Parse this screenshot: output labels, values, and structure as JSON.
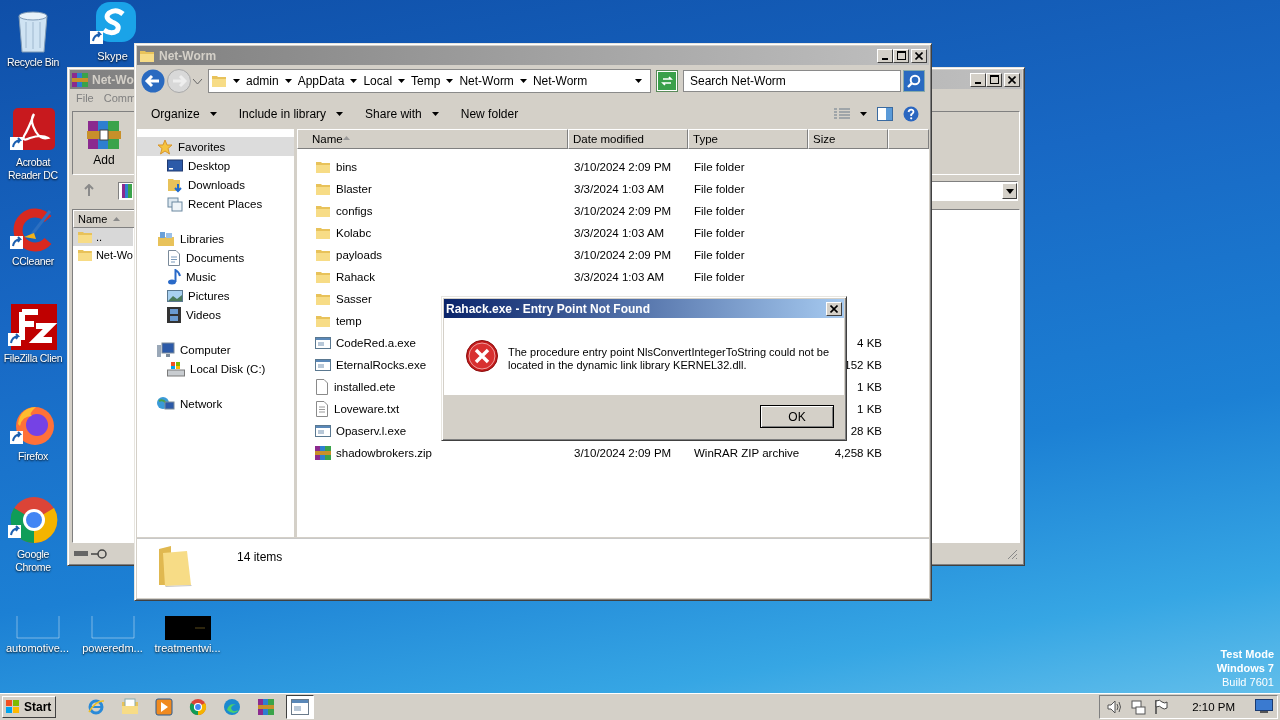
{
  "desktop": {
    "icons": [
      {
        "label": "Recycle Bin",
        "kind": "recycle-bin"
      },
      {
        "label": "Skype",
        "kind": "skype"
      },
      {
        "label": "Acrobat Reader DC",
        "kind": "acrobat"
      },
      {
        "label": "CCleaner",
        "kind": "ccleaner"
      },
      {
        "label": "FileZilla Clien",
        "kind": "filezilla"
      },
      {
        "label": "Firefox",
        "kind": "firefox"
      },
      {
        "label": "Google Chrome",
        "kind": "chrome"
      },
      {
        "label": "automotive...",
        "kind": "blank"
      },
      {
        "label": "poweredm...",
        "kind": "blank"
      },
      {
        "label": "treatmentwi...",
        "kind": "dark"
      }
    ],
    "watermark_text": [
      "Test Mode",
      "Windows 7",
      "Build 7601"
    ]
  },
  "winrar_window": {
    "title": "Net-Wo",
    "menu": [
      "File",
      "Comm"
    ],
    "toolbar": [
      "Add"
    ],
    "column": "Name",
    "rows": [
      {
        "name": "..",
        "selected": true
      },
      {
        "name": "Net-Wo",
        "selected": false
      }
    ]
  },
  "explorer_window": {
    "title": "Net-Worm",
    "breadcrumb": [
      "admin",
      "AppData",
      "Local",
      "Temp",
      "Net-Worm",
      "Net-Worm"
    ],
    "search": {
      "placeholder": "Search Net-Worm"
    },
    "toolbar": [
      {
        "label": "Organize",
        "dropdown": true
      },
      {
        "label": "Include in library",
        "dropdown": true
      },
      {
        "label": "Share with",
        "dropdown": true
      },
      {
        "label": "New folder",
        "dropdown": false
      }
    ],
    "nav": [
      {
        "label": "Favorites",
        "kind": "star",
        "selected": true,
        "children": [
          {
            "label": "Desktop",
            "kind": "desktop",
            "selected": false
          },
          {
            "label": "Downloads",
            "kind": "downloads",
            "selected": false
          },
          {
            "label": "Recent Places",
            "kind": "recent",
            "selected": false
          }
        ]
      },
      {
        "label": "Libraries",
        "kind": "library",
        "selected": false,
        "children": [
          {
            "label": "Documents",
            "kind": "documents",
            "selected": false
          },
          {
            "label": "Music",
            "kind": "music",
            "selected": false
          },
          {
            "label": "Pictures",
            "kind": "pictures",
            "selected": false
          },
          {
            "label": "Videos",
            "kind": "videos",
            "selected": false
          }
        ]
      },
      {
        "label": "Computer",
        "kind": "computer",
        "selected": false,
        "children": [
          {
            "label": "Local Disk (C:)",
            "kind": "disk",
            "selected": false
          }
        ]
      },
      {
        "label": "Network",
        "kind": "network",
        "selected": false
      }
    ],
    "columns": [
      {
        "label": "Name",
        "sorted": true
      },
      {
        "label": "Date modified",
        "sorted": false
      },
      {
        "label": "Type",
        "sorted": false
      },
      {
        "label": "Size",
        "sorted": false
      }
    ],
    "rows": [
      {
        "name": "bins",
        "kind": "folder",
        "date": "3/10/2024 2:09 PM",
        "type": "File folder"
      },
      {
        "name": "Blaster",
        "kind": "folder",
        "date": "3/3/2024 1:03 AM",
        "type": "File folder"
      },
      {
        "name": "configs",
        "kind": "folder",
        "date": "3/10/2024 2:09 PM",
        "type": "File folder"
      },
      {
        "name": "Kolabc",
        "kind": "folder",
        "date": "3/3/2024 1:03 AM",
        "type": "File folder"
      },
      {
        "name": "payloads",
        "kind": "folder",
        "date": "3/10/2024 2:09 PM",
        "type": "File folder"
      },
      {
        "name": "Rahack",
        "kind": "folder",
        "date": "3/3/2024 1:03 AM",
        "type": "File folder"
      },
      {
        "name": "Sasser",
        "kind": "folder"
      },
      {
        "name": "temp",
        "kind": "folder"
      },
      {
        "name": "CodeRed.a.exe",
        "kind": "exe",
        "size": "4 KB"
      },
      {
        "name": "EternalRocks.exe",
        "kind": "exe",
        "size": "152 KB"
      },
      {
        "name": "installed.ete",
        "kind": "file",
        "size": "1 KB"
      },
      {
        "name": "Loveware.txt",
        "kind": "text",
        "size": "1 KB"
      },
      {
        "name": "Opaserv.l.exe",
        "kind": "exe",
        "size": "28 KB"
      },
      {
        "name": "shadowbrokers.zip",
        "kind": "archive",
        "date": "3/10/2024 2:09 PM",
        "type": "WinRAR ZIP archive",
        "size": "4,258 KB"
      }
    ],
    "status": "14 items"
  },
  "dialog": {
    "title": "Rahack.exe - Entry Point Not Found",
    "message": "The procedure entry point NlsConvertIntegerToString could not be located in the dynamic link library KERNEL32.dll.",
    "button": "OK"
  },
  "taskbar": {
    "start": "Start",
    "apps": [
      {
        "kind": "ie",
        "selected": false
      },
      {
        "kind": "explorer",
        "selected": false
      },
      {
        "kind": "media",
        "selected": false
      },
      {
        "kind": "chrome",
        "selected": false
      },
      {
        "kind": "edge",
        "selected": false
      },
      {
        "kind": "winrar",
        "selected": false
      },
      {
        "kind": "window",
        "selected": true
      }
    ],
    "clock": "2:10 PM"
  }
}
